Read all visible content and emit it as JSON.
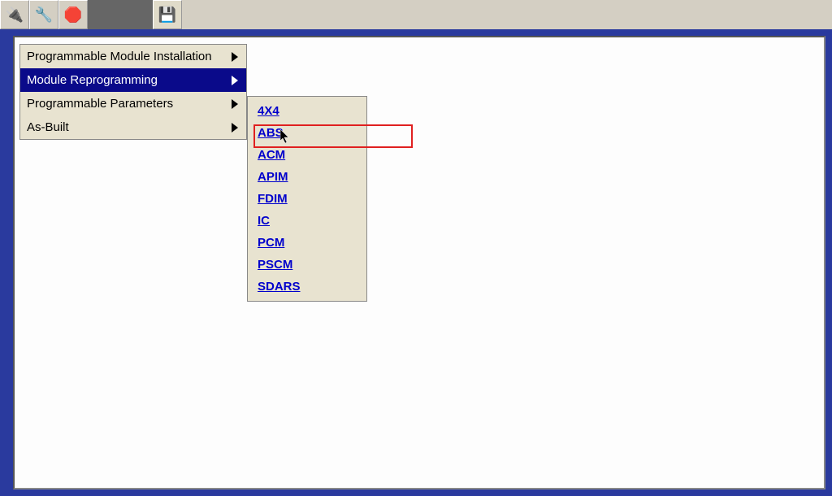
{
  "toolbar": {
    "icons": [
      "🔌",
      "🔧",
      "🛑",
      "💾"
    ]
  },
  "main_menu": {
    "items": [
      {
        "label": "Programmable Module Installation",
        "has_sub": true,
        "selected": false
      },
      {
        "label": "Module Reprogramming",
        "has_sub": true,
        "selected": true
      },
      {
        "label": "Programmable Parameters",
        "has_sub": true,
        "selected": false
      },
      {
        "label": "As-Built",
        "has_sub": true,
        "selected": false
      }
    ]
  },
  "sub_menu": {
    "items": [
      {
        "label": "4X4"
      },
      {
        "label": "ABS"
      },
      {
        "label": "ACM"
      },
      {
        "label": "APIM"
      },
      {
        "label": "FDIM"
      },
      {
        "label": "IC"
      },
      {
        "label": "PCM"
      },
      {
        "label": "PSCM"
      },
      {
        "label": "SDARS"
      }
    ],
    "highlighted_index": 1
  }
}
